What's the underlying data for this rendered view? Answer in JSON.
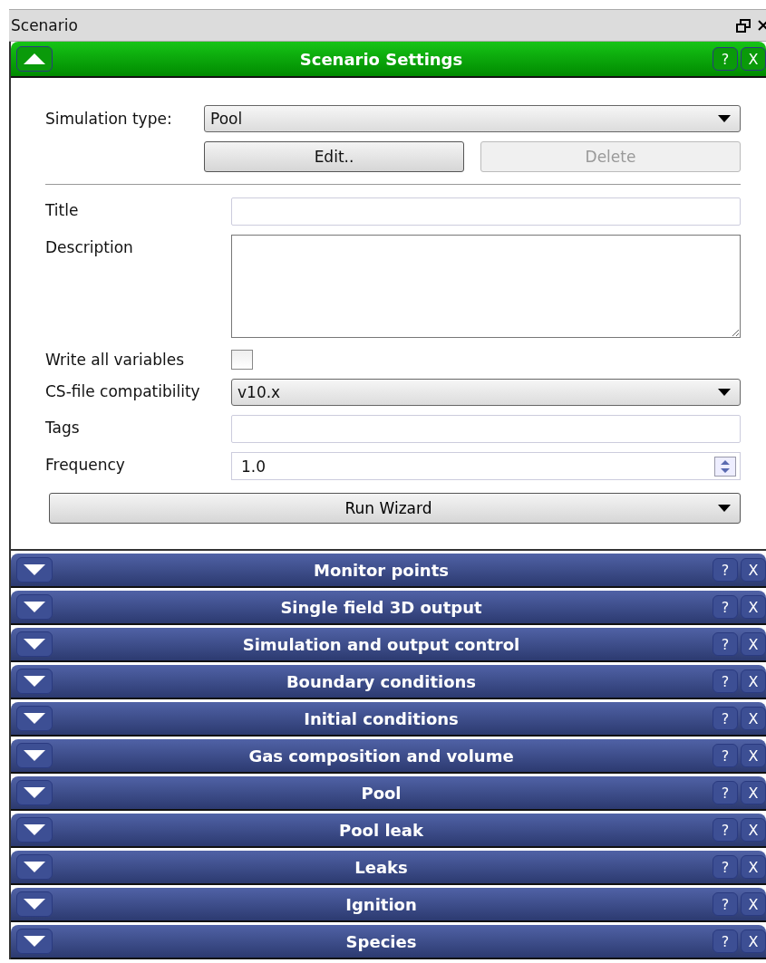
{
  "window": {
    "title": "Scenario"
  },
  "sections": [
    {
      "title": "Scenario Settings",
      "expanded": true,
      "help": "?",
      "close": "X"
    },
    {
      "title": "Monitor points",
      "expanded": false,
      "help": "?",
      "close": "X"
    },
    {
      "title": "Single field 3D output",
      "expanded": false,
      "help": "?",
      "close": "X"
    },
    {
      "title": "Simulation and output control",
      "expanded": false,
      "help": "?",
      "close": "X"
    },
    {
      "title": "Boundary conditions",
      "expanded": false,
      "help": "?",
      "close": "X"
    },
    {
      "title": "Initial conditions",
      "expanded": false,
      "help": "?",
      "close": "X"
    },
    {
      "title": "Gas composition and volume",
      "expanded": false,
      "help": "?",
      "close": "X"
    },
    {
      "title": "Pool",
      "expanded": false,
      "help": "?",
      "close": "X"
    },
    {
      "title": "Pool leak",
      "expanded": false,
      "help": "?",
      "close": "X"
    },
    {
      "title": "Leaks",
      "expanded": false,
      "help": "?",
      "close": "X"
    },
    {
      "title": "Ignition",
      "expanded": false,
      "help": "?",
      "close": "X"
    },
    {
      "title": "Species",
      "expanded": false,
      "help": "?",
      "close": "X"
    }
  ],
  "settings": {
    "simulation_type": {
      "label": "Simulation type:",
      "value": "Pool"
    },
    "buttons": [
      {
        "label": "Edit..",
        "disabled": false
      },
      {
        "label": "Delete",
        "disabled": true
      }
    ],
    "fields": [
      {
        "kind": "text",
        "label": "Title"
      },
      {
        "kind": "textarea",
        "label": "Description"
      },
      {
        "kind": "checkbox",
        "label": "Write all variables",
        "checked": false
      },
      {
        "kind": "select",
        "label": "CS-file compatibility",
        "value": "v10.x"
      },
      {
        "kind": "text",
        "label": "Tags"
      },
      {
        "kind": "spin",
        "label": "Frequency",
        "value": "1.0"
      }
    ],
    "run_wizard": {
      "label": "Run Wizard"
    }
  }
}
